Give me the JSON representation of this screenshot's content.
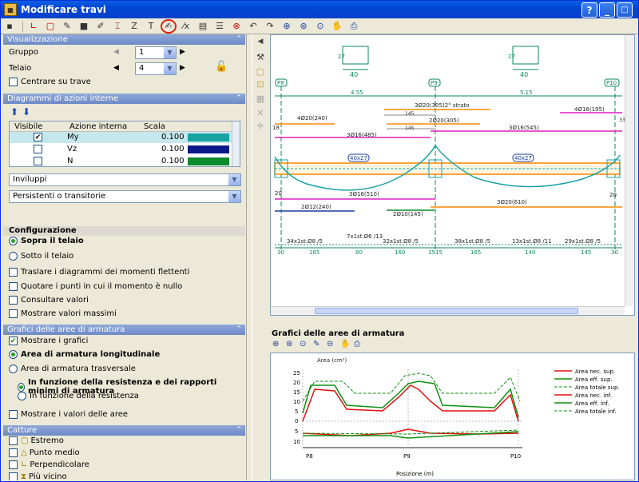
{
  "window": {
    "title": "Modificare travi"
  },
  "title_buttons": {
    "help": "?",
    "minimize": "_",
    "maximize": "□",
    "close": "X"
  },
  "visualizzazione": {
    "header": "Visualizzazione",
    "gruppo_label": "Gruppo",
    "gruppo_value": "1",
    "telaio_label": "Telaio",
    "telaio_value": "4",
    "centrare": "Centrare su trave"
  },
  "diagrammi": {
    "header": "Diagrammi di azioni interne",
    "columns": [
      "Visibile",
      "Azione interna",
      "Scala"
    ],
    "rows": [
      {
        "name": "My",
        "scale": "0.100",
        "checked": true,
        "color": "#1aa3a3"
      },
      {
        "name": "Vz",
        "scale": "0.100",
        "checked": false,
        "color": "#0a1a8a"
      },
      {
        "name": "N",
        "scale": "0.100",
        "checked": false,
        "color": "#0a8a2a"
      }
    ],
    "combo1": "Inviluppi",
    "combo2": "Persistenti o transitorie"
  },
  "configurazione": {
    "header": "Configurazione",
    "opt1": "Sopra il telaio",
    "opt2": "Sotto il telaio",
    "chk1": "Traslare i diagrammi dei momenti flettenti",
    "chk2": "Quotare i punti in cui il momento è nullo",
    "chk3": "Consultare valori",
    "chk4": "Mostrare valori massimi"
  },
  "grafici": {
    "header": "Grafici delle aree di armatura",
    "mostrare": "Mostrare i grafici",
    "area_long": "Area di armatura longitudinale",
    "area_trasv": "Area di armatura trasversale",
    "sub1": "In funzione della resistenza e dei rapporti minimi di armatura",
    "sub2": "In funzione della resistenza",
    "mostrare_valori": "Mostrare i valori delle aree"
  },
  "catture": {
    "header": "Catture",
    "items": [
      "Estremo",
      "Punto medio",
      "Perpendicolare",
      "Più vicino"
    ]
  },
  "drawing": {
    "dims": [
      "40",
      "40"
    ],
    "section_dims": [
      "27",
      "27"
    ],
    "nodes": [
      "P8",
      "P9",
      "P10"
    ],
    "spans": [
      "4.55",
      "5.15"
    ],
    "top_bars": [
      "3Ø20(305)2° strato",
      "145",
      "2Ø20(305)",
      "145",
      "4Ø20(240)",
      "3Ø16(485)",
      "3Ø16(545)",
      "4Ø16(195)"
    ],
    "beams": [
      "40x27",
      "40x27"
    ],
    "bottom_bars": [
      "3Ø16(510)",
      "3Ø20(610)",
      "2Ø12(240)",
      "2Ø10(145)"
    ],
    "stirrups": [
      "34x1st.Ø8 /5",
      "7x1st.Ø6 /13",
      "32x1st.Ø8 /5",
      "38x1st.Ø8 /5",
      "13x1st.Ø8 /11",
      "29x1st.Ø8 /5"
    ],
    "bottom_dims": [
      "30",
      "165",
      "80",
      "160",
      "15",
      "15",
      "165",
      "140",
      "145",
      "30"
    ],
    "side_labels": [
      "18",
      "20",
      "20"
    ],
    "misc": [
      "33"
    ]
  },
  "graph": {
    "title": "Grafici delle aree di armatura",
    "ylabel": "Area (cm²)",
    "xlabel": "Posizione (m)",
    "yticks": [
      "25",
      "20",
      "15",
      "10",
      "5",
      "0",
      "5",
      "10"
    ],
    "xticks": [
      "P8",
      "P9",
      "P10"
    ],
    "legend": [
      {
        "label": "Area nec. sup.",
        "color": "#e01010",
        "style": "solid"
      },
      {
        "label": "Area eff. sup.",
        "color": "#109010",
        "style": "solid"
      },
      {
        "label": "Area totale sup.",
        "color": "#109010",
        "style": "dashed"
      },
      {
        "label": "Area nec. inf.",
        "color": "#e01010",
        "style": "solid"
      },
      {
        "label": "Area eff. inf.",
        "color": "#109010",
        "style": "solid"
      },
      {
        "label": "Area totale inf.",
        "color": "#109010",
        "style": "dashed"
      }
    ]
  }
}
